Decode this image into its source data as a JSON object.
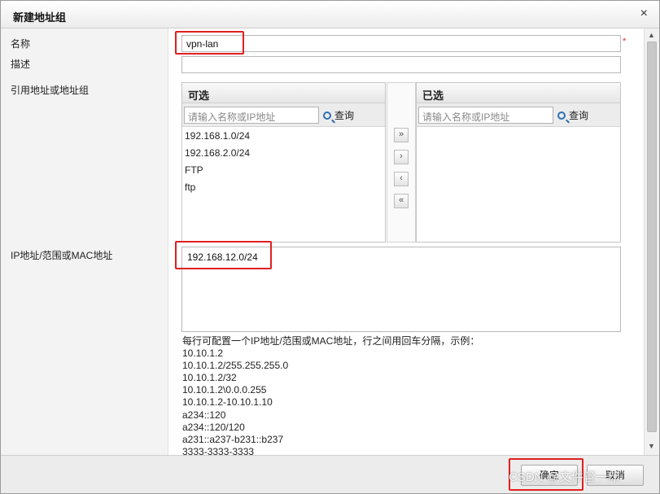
{
  "dialog": {
    "title": "新建地址组",
    "close_glyph": "×"
  },
  "form": {
    "name_label": "名称",
    "name_value": "vpn-lan",
    "required_mark": "*",
    "desc_label": "描述",
    "desc_value": "",
    "ref_label": "引用地址或地址组",
    "ip_label": "IP地址/范围或MAC地址",
    "ip_value": "192.168.12.0/24"
  },
  "available": {
    "title": "可选",
    "search_placeholder": "请输入名称或IP地址",
    "search_label": "查询",
    "items": [
      "192.168.1.0/24",
      "192.168.2.0/24",
      "FTP",
      "ftp"
    ]
  },
  "selected": {
    "title": "已选",
    "search_placeholder": "请输入名称或IP地址",
    "search_label": "查询",
    "items": []
  },
  "move_buttons": {
    "add_all": "»",
    "add": "›",
    "remove": "‹",
    "remove_all": "«"
  },
  "help": {
    "intro": "每行可配置一个IP地址/范围或MAC地址，行之间用回车分隔，示例：",
    "examples": [
      "10.10.1.2",
      "10.10.1.2/255.255.255.0",
      "10.10.1.2/32",
      "10.10.1.2\\0.0.0.255",
      "10.10.1.2-10.10.1.10",
      "a234::120",
      "a234::120/120",
      "a231::a237-b231::b237",
      "3333-3333-3333"
    ]
  },
  "footer": {
    "ok_label": "确定",
    "cancel_label": "取消"
  },
  "watermark": "CSDN @文件管一印",
  "colors": {
    "highlight": "#e02020",
    "required": "#e0262c",
    "search_icon": "#2f6fb5"
  },
  "icons": {
    "search": "search-icon",
    "close": "close-icon"
  }
}
